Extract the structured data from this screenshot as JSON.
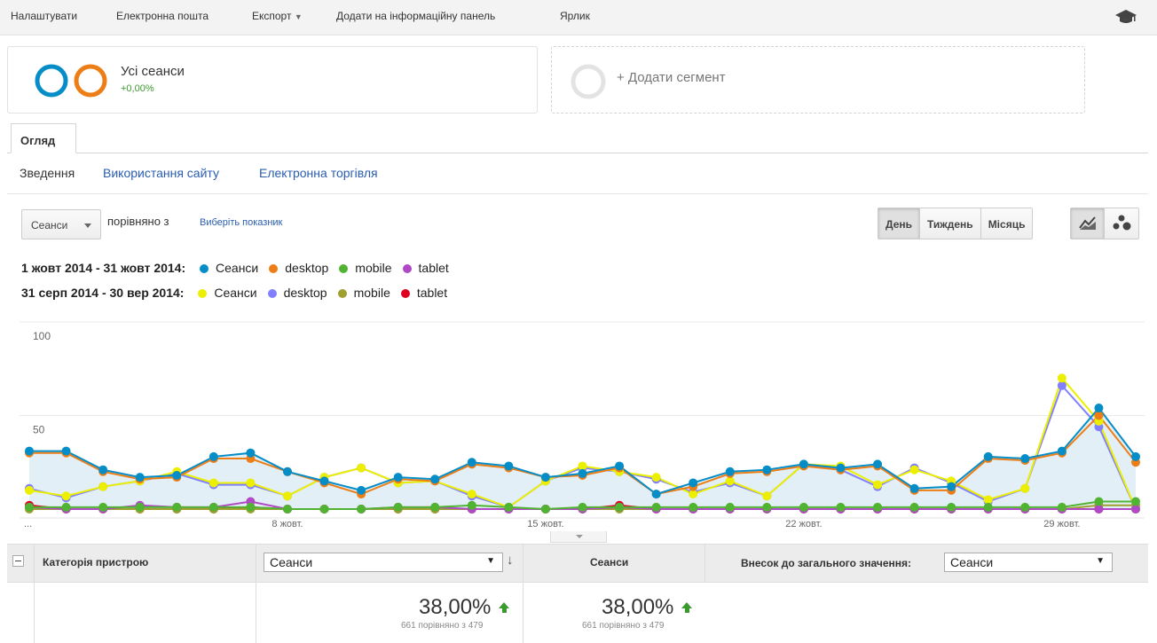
{
  "toolbar": {
    "customize": "Налаштувати",
    "email": "Електронна пошта",
    "export": "Експорт",
    "add_dashboard": "Додати на інформаційну панель",
    "shortcut": "Ярлик",
    "academy_icon": "graduation-cap-icon"
  },
  "segments": {
    "all_sessions": {
      "name": "Усі сеанси",
      "delta": "+0,00%",
      "colors": [
        "#058dc7",
        "#ed7e17"
      ]
    },
    "add_segment": "+ Додати сегмент"
  },
  "tabs": {
    "overview": "Огляд"
  },
  "subnav": {
    "summary": "Зведення",
    "site_usage": "Використання сайту",
    "ecommerce": "Електронна торгівля"
  },
  "controls": {
    "metric": "Сеанси",
    "compare_label": "порівняно з",
    "choose_metric": "Виберіть показник",
    "day": "День",
    "week": "Тиждень",
    "month": "Місяць",
    "active_granularity": "day",
    "line_chart_icon": "line-chart-icon",
    "motion_chart_icon": "motion-chart-icon"
  },
  "legend": {
    "range1": "1 жовт 2014 - 31 жовт 2014:",
    "range2": "31 серп 2014 - 30 вер 2014:",
    "items1": [
      {
        "label": "Сеанси",
        "color": "#058dc7"
      },
      {
        "label": "desktop",
        "color": "#ed7e17"
      },
      {
        "label": "mobile",
        "color": "#50b432"
      },
      {
        "label": "tablet",
        "color": "#af49c5"
      }
    ],
    "items2": [
      {
        "label": "Сеанси",
        "color": "#edef00"
      },
      {
        "label": "desktop",
        "color": "#8080ff"
      },
      {
        "label": "mobile",
        "color": "#a0a030"
      },
      {
        "label": "tablet",
        "color": "#e00020"
      }
    ]
  },
  "chart_data": {
    "type": "line",
    "ylim": [
      0,
      100
    ],
    "y_ticks": [
      100,
      50
    ],
    "x_tick_labels": [
      "...",
      "8 жовт.",
      "15 жовт.",
      "22 жовт.",
      "29 жовт."
    ],
    "x_tick_index": [
      0,
      7,
      14,
      21,
      28
    ],
    "x": [
      1,
      2,
      3,
      4,
      5,
      6,
      7,
      8,
      9,
      10,
      11,
      12,
      13,
      14,
      15,
      16,
      17,
      18,
      19,
      20,
      21,
      22,
      23,
      24,
      25,
      26,
      27,
      28,
      29,
      30,
      31
    ],
    "grid": true,
    "series": [
      {
        "name": "Сеанси",
        "period": "1 жовт 2014 - 31 жовт 2014",
        "color": "#058dc7",
        "area": true,
        "values": [
          31,
          31,
          21,
          17,
          18,
          28,
          30,
          20,
          15,
          10,
          17,
          16,
          25,
          23,
          17,
          19,
          23,
          8,
          14,
          20,
          21,
          24,
          22,
          24,
          11,
          12,
          28,
          27,
          31,
          54,
          28
        ]
      },
      {
        "name": "desktop",
        "period": "1 жовт 2014 - 31 жовт 2014",
        "color": "#ed7e17",
        "values": [
          30,
          30,
          20,
          16,
          17,
          27,
          27,
          20,
          14,
          8,
          16,
          15,
          24,
          22,
          17,
          18,
          22,
          8,
          12,
          19,
          20,
          23,
          21,
          23,
          10,
          10,
          27,
          26,
          30,
          50,
          25
        ]
      },
      {
        "name": "mobile",
        "period": "1 жовт 2014 - 31 жовт 2014",
        "color": "#50b432",
        "values": [
          1,
          1,
          1,
          1,
          1,
          1,
          1,
          0,
          0,
          0,
          1,
          1,
          2,
          1,
          0,
          1,
          1,
          1,
          1,
          1,
          1,
          1,
          1,
          1,
          1,
          1,
          1,
          1,
          1,
          4,
          4
        ]
      },
      {
        "name": "tablet",
        "period": "1 жовт 2014 - 31 жовт 2014",
        "color": "#af49c5",
        "values": [
          1,
          0,
          0,
          2,
          1,
          1,
          4,
          0,
          0,
          0,
          1,
          1,
          0,
          0,
          0,
          0,
          1,
          0,
          0,
          0,
          0,
          0,
          0,
          0,
          0,
          0,
          0,
          0,
          0,
          0,
          0
        ]
      },
      {
        "name": "Сеанси",
        "period": "31 серп 2014 - 30 вер 2014",
        "color": "#edef00",
        "values": [
          10,
          7,
          12,
          15,
          20,
          14,
          14,
          7,
          17,
          22,
          14,
          15,
          8,
          1,
          15,
          23,
          20,
          17,
          8,
          15,
          7,
          24,
          23,
          13,
          21,
          15,
          5,
          11,
          70,
          47,
          0
        ]
      },
      {
        "name": "desktop",
        "period": "31 серп 2014 - 30 вер 2014",
        "color": "#8080ff",
        "values": [
          11,
          6,
          12,
          15,
          19,
          13,
          13,
          7,
          17,
          22,
          14,
          15,
          7,
          1,
          15,
          22,
          20,
          16,
          9,
          14,
          7,
          24,
          21,
          12,
          22,
          14,
          4,
          11,
          66,
          44,
          0
        ]
      },
      {
        "name": "mobile",
        "period": "31 серп 2014 - 30 вер 2014",
        "color": "#a0a030",
        "values": [
          0,
          0,
          0,
          0,
          0,
          0,
          0,
          0,
          0,
          0,
          0,
          0,
          0,
          0,
          0,
          0,
          0,
          0,
          0,
          0,
          0,
          0,
          0,
          0,
          0,
          0,
          0,
          0,
          0,
          2,
          2
        ]
      },
      {
        "name": "tablet",
        "period": "31 серп 2014 - 30 вер 2014",
        "color": "#e00020",
        "values": [
          2,
          0,
          0,
          0,
          0,
          0,
          1,
          0,
          0,
          0,
          0,
          0,
          0,
          0,
          0,
          0,
          2,
          0,
          0,
          0,
          0,
          0,
          0,
          0,
          0,
          0,
          0,
          0,
          0,
          0,
          0
        ]
      }
    ]
  },
  "table": {
    "dimension": "Категорія пристрою",
    "metric_select": "Сеанси",
    "metric_header": "Сеанси",
    "contribution_label": "Внесок до загального значення:",
    "contribution_select": "Сеанси",
    "total1": {
      "value": "38,00%",
      "sub": "661 порівняно з 479"
    },
    "total2": {
      "value": "38,00%",
      "sub": "661 порівняно з 479"
    }
  }
}
